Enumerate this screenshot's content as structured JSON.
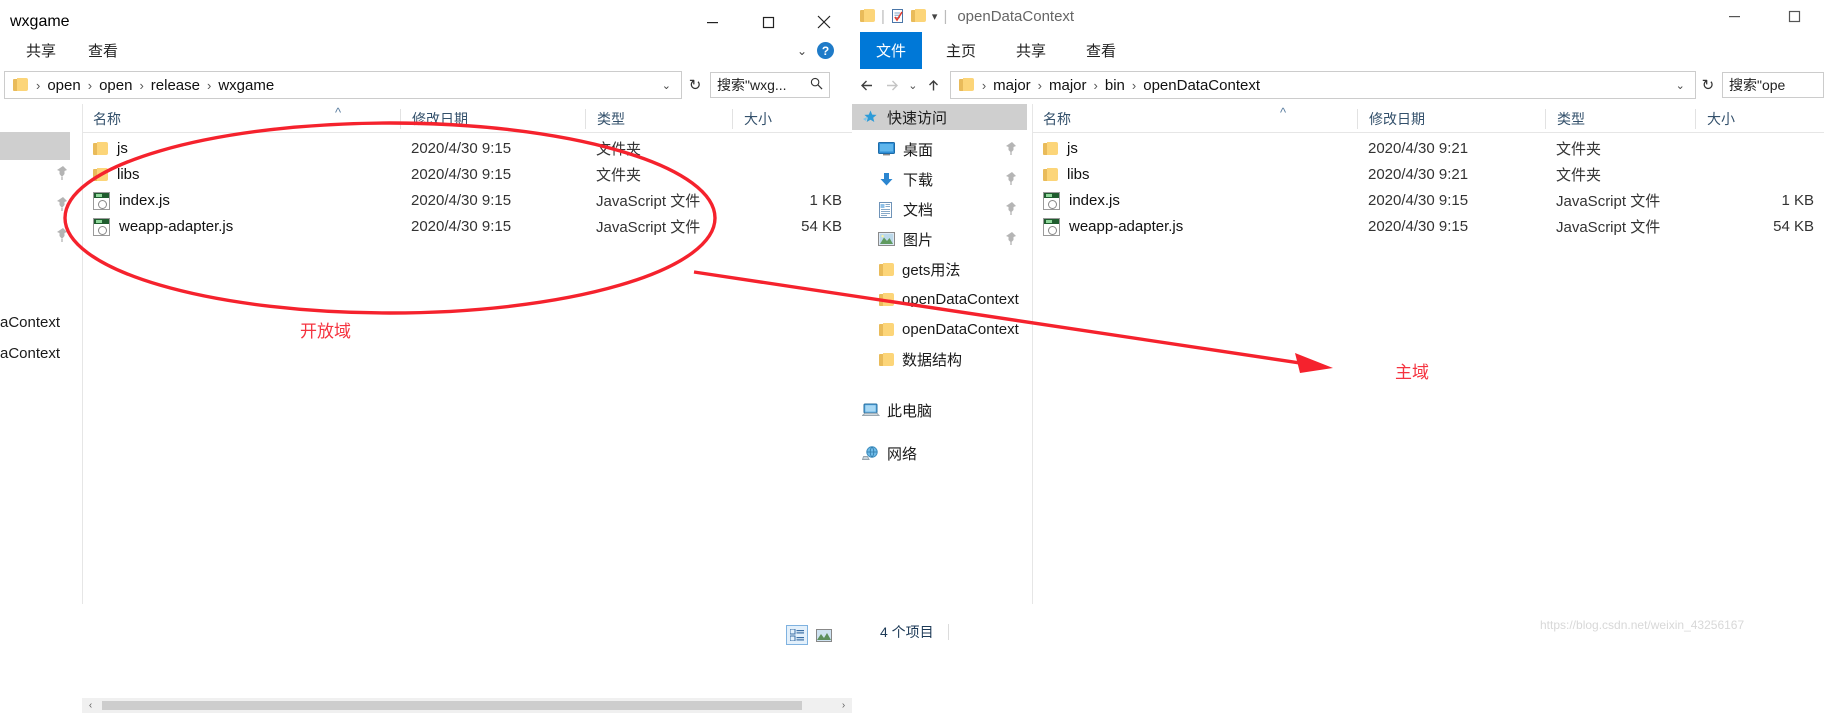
{
  "left_window": {
    "title": "wxgame",
    "window_controls": {
      "minimize": "minimize-icon",
      "maximize": "maximize-icon",
      "close": "close-icon"
    },
    "ribbon_tabs": [
      "共享",
      "查看"
    ],
    "help_icon": "help-icon",
    "address": {
      "crumbs": [
        "open",
        "open",
        "release",
        "wxgame"
      ],
      "refresh_label": "↻"
    },
    "search": {
      "placeholder": "搜索\"wxg...",
      "icon": "search-icon"
    },
    "columns": [
      "名称",
      "修改日期",
      "类型",
      "大小"
    ],
    "sort_indicator": "^",
    "files": [
      {
        "name": "js",
        "date": "2020/4/30 9:15",
        "type": "文件夹",
        "size": "",
        "icon": "folder-icon"
      },
      {
        "name": "libs",
        "date": "2020/4/30 9:15",
        "type": "文件夹",
        "size": "",
        "icon": "folder-icon"
      },
      {
        "name": "index.js",
        "date": "2020/4/30 9:15",
        "type": "JavaScript 文件",
        "size": "1 KB",
        "icon": "js-file-icon"
      },
      {
        "name": "weapp-adapter.js",
        "date": "2020/4/30 9:15",
        "type": "JavaScript 文件",
        "size": "54 KB",
        "icon": "js-file-icon"
      }
    ],
    "clipped_sidebar_labels": [
      "aContext",
      "aContext"
    ]
  },
  "right_window": {
    "title": "openDataContext",
    "quick_access_icons": [
      "folder-icon",
      "properties-icon",
      "new-folder-icon",
      "dropdown-arrow-icon"
    ],
    "window_controls": {
      "minimize": "minimize-icon",
      "maximize": "maximize-icon"
    },
    "ribbon_tabs": [
      "文件",
      "主页",
      "共享",
      "查看"
    ],
    "active_ribbon_tab": "文件",
    "address": {
      "crumbs": [
        "major",
        "major",
        "bin",
        "openDataContext"
      ],
      "back": "back-arrow-icon",
      "forward": "forward-arrow-icon",
      "recent": "recent-dropdown-icon",
      "up": "up-arrow-icon",
      "refresh_label": "↻"
    },
    "search": {
      "placeholder": "搜索\"ope",
      "icon": "search-icon"
    },
    "sidebar": {
      "header": {
        "label": "快速访问",
        "icon": "quick-access-star-icon",
        "selected": true
      },
      "items": [
        {
          "label": "桌面",
          "icon": "desktop-icon",
          "pinned": true
        },
        {
          "label": "下载",
          "icon": "downloads-icon",
          "pinned": true
        },
        {
          "label": "文档",
          "icon": "documents-icon",
          "pinned": true
        },
        {
          "label": "图片",
          "icon": "pictures-icon",
          "pinned": true
        },
        {
          "label": "gets用法",
          "icon": "folder-icon",
          "pinned": false
        },
        {
          "label": "openDataContext",
          "icon": "folder-icon",
          "pinned": false
        },
        {
          "label": "openDataContext",
          "icon": "folder-icon",
          "pinned": false
        },
        {
          "label": "数据结构",
          "icon": "folder-icon",
          "pinned": false
        }
      ],
      "this_pc": {
        "label": "此电脑",
        "icon": "this-pc-icon"
      },
      "network": {
        "label": "网络",
        "icon": "network-icon"
      }
    },
    "columns": [
      "名称",
      "修改日期",
      "类型",
      "大小"
    ],
    "sort_indicator": "^",
    "files": [
      {
        "name": "js",
        "date": "2020/4/30 9:21",
        "type": "文件夹",
        "size": "",
        "icon": "folder-icon"
      },
      {
        "name": "libs",
        "date": "2020/4/30 9:21",
        "type": "文件夹",
        "size": "",
        "icon": "folder-icon"
      },
      {
        "name": "index.js",
        "date": "2020/4/30 9:15",
        "type": "JavaScript 文件",
        "size": "1 KB",
        "icon": "js-file-icon"
      },
      {
        "name": "weapp-adapter.js",
        "date": "2020/4/30 9:15",
        "type": "JavaScript 文件",
        "size": "54 KB",
        "icon": "js-file-icon"
      }
    ],
    "status": {
      "item_count": "4 个项目",
      "details_view_icon": "details-view-icon",
      "thumbnail_view_icon": "thumbnail-view-icon"
    }
  },
  "annotations": {
    "open_domain_label": "开放域",
    "main_domain_label": "主域",
    "accent_color": "#f5333f"
  },
  "watermark": "https://blog.csdn.net/weixin_43256167"
}
